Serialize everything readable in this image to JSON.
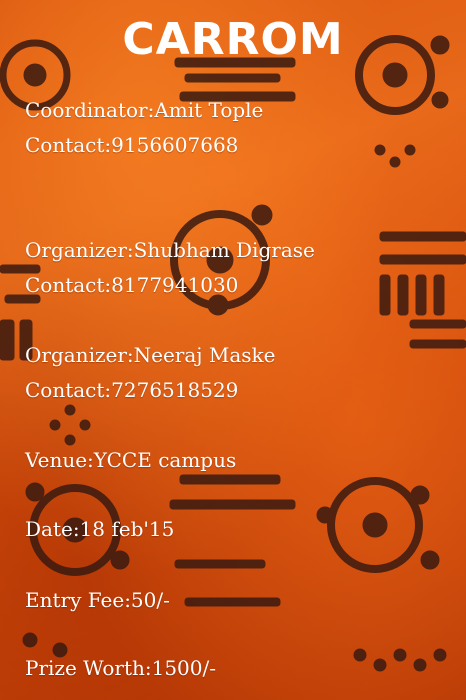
{
  "title": "CARROM",
  "lines": [
    "Coordinator:Amit Tople",
    "Contact:9156607668",
    "Organizer:Shubham Digrase",
    "Contact:8177941030",
    "Organizer:Neeraj Maske",
    "Contact:7276518529",
    "Venue:YCCE campus",
    "Date:18 feb'15",
    "Entry Fee:50/-",
    "Prize Worth:1500/-"
  ],
  "colors": {
    "background": "#d9560f",
    "motif": "#3a1a10",
    "text": "#ffffff"
  }
}
